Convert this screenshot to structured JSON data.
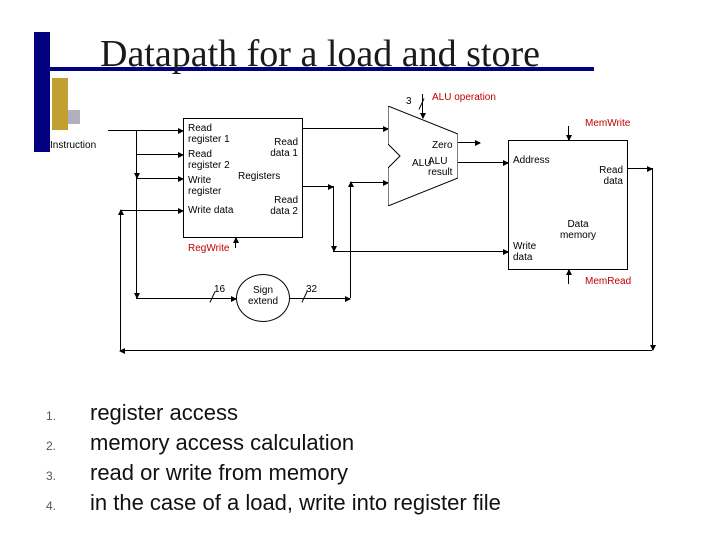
{
  "title": "Datapath for a load and store",
  "steps": [
    {
      "num": "1.",
      "text": "register access"
    },
    {
      "num": "2.",
      "text": "memory access calculation"
    },
    {
      "num": "3.",
      "text": "read or write from memory"
    },
    {
      "num": "4.",
      "text": "in the case of a load, write into register file"
    }
  ],
  "diagram": {
    "instruction": "Instruction",
    "registers_block": "Registers",
    "read_reg1": "Read register 1",
    "read_reg2": "Read register 2",
    "write_reg": "Write register",
    "write_data_in": "Write data",
    "read_data1": "Read data 1",
    "read_data2": "Read data 2",
    "regwrite": "RegWrite",
    "alu_op": "ALU operation",
    "alu_op_bits": "3",
    "alu_zero": "Zero",
    "alu_name": "ALU",
    "alu_result": "ALU result",
    "address": "Address",
    "write_data_mem": "Write data",
    "read_data_mem": "Read data",
    "data_memory": "Data memory",
    "memwrite": "MemWrite",
    "memread": "MemRead",
    "sign_extend": "Sign extend",
    "bits16": "16",
    "bits32": "32"
  }
}
